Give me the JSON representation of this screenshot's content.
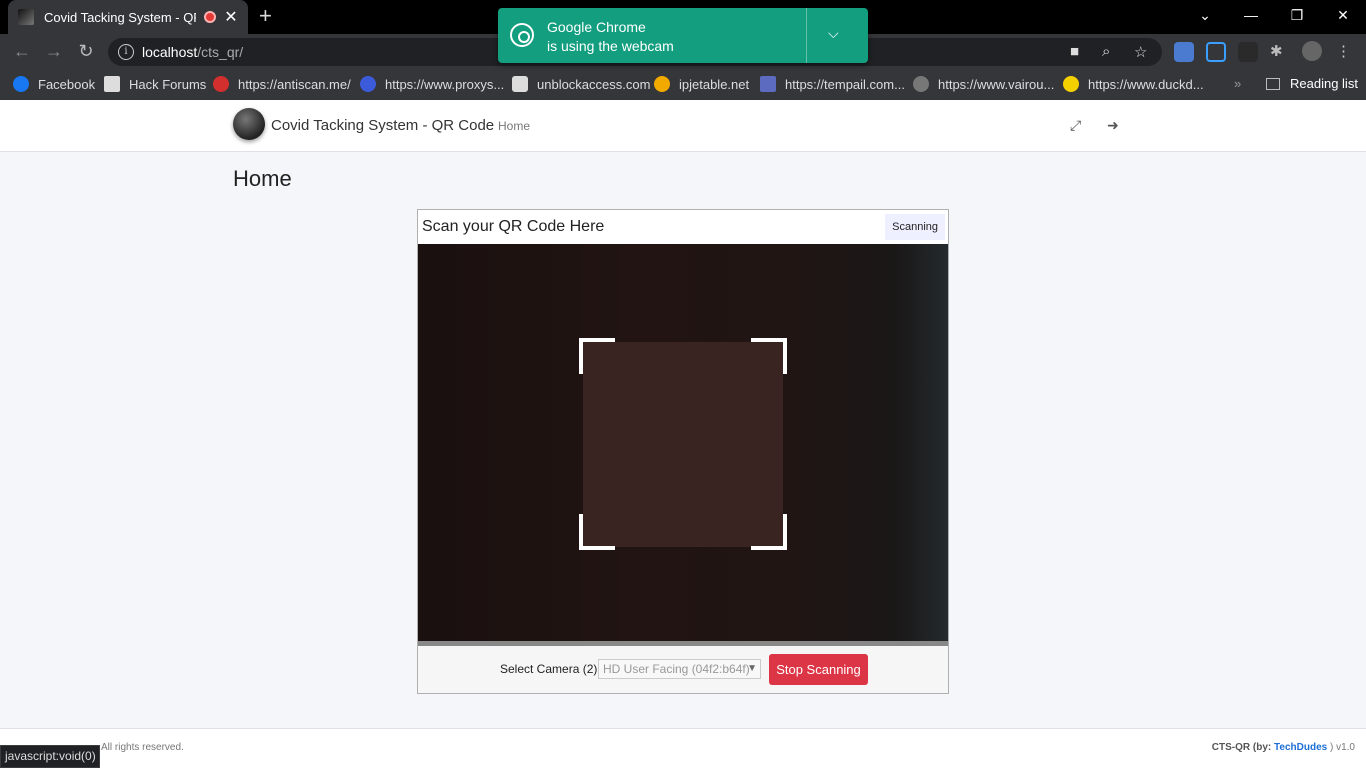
{
  "browser": {
    "tab_title": "Covid Tacking System - QR C",
    "url_host": "localhost",
    "url_path": "/cts_qr/",
    "bookmarks": [
      {
        "label": "Facebook",
        "color": "#1877f2"
      },
      {
        "label": "Hack Forums",
        "color": "#dddddd"
      },
      {
        "label": "https://antiscan.me/",
        "color": "#d32f2f"
      },
      {
        "label": "https://www.proxys...",
        "color": "#3b5bdb"
      },
      {
        "label": "unblockaccess.com",
        "color": "#dddddd"
      },
      {
        "label": "ipjetable.net",
        "color": "#f2a900"
      },
      {
        "label": "https://tempail.com...",
        "color": "#5c6bc0"
      },
      {
        "label": "https://www.vairou...",
        "color": "#777777"
      },
      {
        "label": "https://www.duckd...",
        "color": "#f5d000"
      }
    ],
    "bookmarks_more": "»",
    "reading_list": "Reading list",
    "status_url": "javascript:void(0)"
  },
  "notification": {
    "line1": "Google Chrome",
    "line2": "is using the webcam"
  },
  "app": {
    "brand": "Covid Tacking System - QR Code",
    "nav_home": "Home",
    "page_title": "Home",
    "scanner": {
      "title": "Scan your QR Code Here",
      "status": "Scanning",
      "camera_label": "Select Camera (2)",
      "camera_value": "HD User Facing (04f2:b64f)",
      "stop_button": "Stop Scanning"
    },
    "footer": {
      "left": "All rights reserved.",
      "right_prefix": "CTS-QR (by:",
      "right_link": "TechDudes",
      "right_suffix": ") v1.0"
    }
  }
}
